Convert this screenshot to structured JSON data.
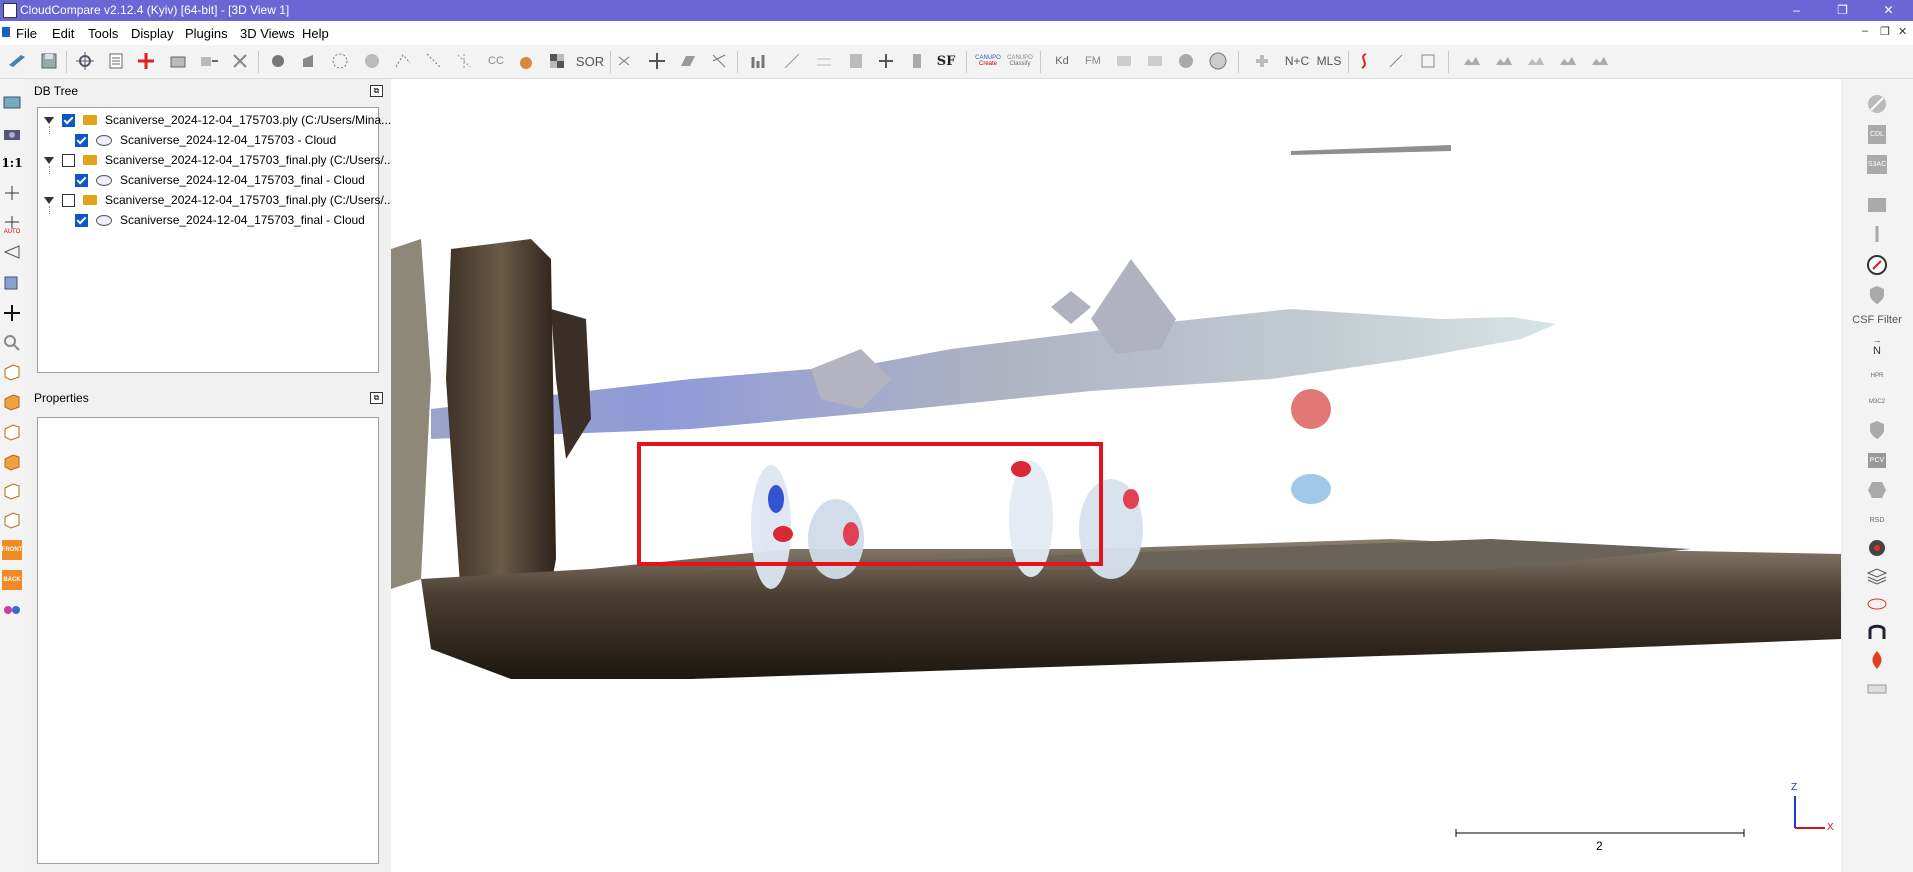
{
  "window": {
    "title": "CloudCompare v2.12.4 (Kyiv) [64-bit] - [3D View 1]",
    "controls": {
      "minimize": "–",
      "maximize": "❐",
      "close": "✕"
    }
  },
  "menu": {
    "items": [
      "File",
      "Edit",
      "Tools",
      "Display",
      "Plugins",
      "3D Views",
      "Help"
    ],
    "mdi_controls": {
      "minimize": "–",
      "restore": "❐",
      "close": "✕"
    }
  },
  "toolbar": {
    "text_buttons": {
      "sor": "SOR",
      "sf": "SF",
      "kd": "Kd",
      "fm": "FM",
      "nc": "N+C",
      "mls": "MLS",
      "cc": "CC",
      "canupo_create": "Create",
      "canupo_classify": "Classify",
      "canupo": "CANUPO"
    }
  },
  "left_toolbar": {
    "one_to_one": "1:1",
    "auto": "AUTO",
    "front": "FRONT",
    "back": "BACK"
  },
  "db_tree": {
    "title": "DB Tree",
    "items": [
      {
        "label": "Scaniverse_2024-12-04_175703.ply (C:/Users/Mina...",
        "checked": true,
        "child": {
          "label": "Scaniverse_2024-12-04_175703 - Cloud",
          "checked": true
        }
      },
      {
        "label": "Scaniverse_2024-12-04_175703_final.ply (C:/Users/...",
        "checked": false,
        "child": {
          "label": "Scaniverse_2024-12-04_175703_final - Cloud",
          "checked": true
        }
      },
      {
        "label": "Scaniverse_2024-12-04_175703_final.ply (C:/Users/...",
        "checked": false,
        "child": {
          "label": "Scaniverse_2024-12-04_175703_final - Cloud",
          "checked": true
        }
      }
    ]
  },
  "properties": {
    "title": "Properties"
  },
  "right_toolbar": {
    "csf_label": "CSF Filter",
    "north": "N",
    "cdl": "CDL",
    "hpr": "HPR",
    "m3c2": "M3C2",
    "pcv": "PCV",
    "rsd": "RSD",
    "s3ac": "S3AC"
  },
  "view": {
    "scale_label": "2",
    "axis_z": "Z",
    "axis_x": "X",
    "highlight_color": "#e3141c"
  }
}
